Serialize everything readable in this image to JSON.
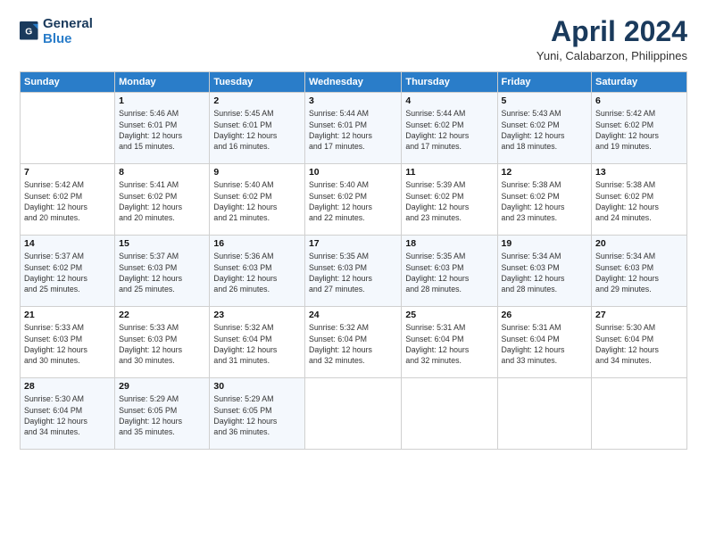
{
  "header": {
    "logo_line1": "General",
    "logo_line2": "Blue",
    "title": "April 2024",
    "location": "Yuni, Calabarzon, Philippines"
  },
  "calendar": {
    "days_of_week": [
      "Sunday",
      "Monday",
      "Tuesday",
      "Wednesday",
      "Thursday",
      "Friday",
      "Saturday"
    ],
    "weeks": [
      [
        {
          "day": "",
          "info": ""
        },
        {
          "day": "1",
          "info": "Sunrise: 5:46 AM\nSunset: 6:01 PM\nDaylight: 12 hours\nand 15 minutes."
        },
        {
          "day": "2",
          "info": "Sunrise: 5:45 AM\nSunset: 6:01 PM\nDaylight: 12 hours\nand 16 minutes."
        },
        {
          "day": "3",
          "info": "Sunrise: 5:44 AM\nSunset: 6:01 PM\nDaylight: 12 hours\nand 17 minutes."
        },
        {
          "day": "4",
          "info": "Sunrise: 5:44 AM\nSunset: 6:02 PM\nDaylight: 12 hours\nand 17 minutes."
        },
        {
          "day": "5",
          "info": "Sunrise: 5:43 AM\nSunset: 6:02 PM\nDaylight: 12 hours\nand 18 minutes."
        },
        {
          "day": "6",
          "info": "Sunrise: 5:42 AM\nSunset: 6:02 PM\nDaylight: 12 hours\nand 19 minutes."
        }
      ],
      [
        {
          "day": "7",
          "info": "Sunrise: 5:42 AM\nSunset: 6:02 PM\nDaylight: 12 hours\nand 20 minutes."
        },
        {
          "day": "8",
          "info": "Sunrise: 5:41 AM\nSunset: 6:02 PM\nDaylight: 12 hours\nand 20 minutes."
        },
        {
          "day": "9",
          "info": "Sunrise: 5:40 AM\nSunset: 6:02 PM\nDaylight: 12 hours\nand 21 minutes."
        },
        {
          "day": "10",
          "info": "Sunrise: 5:40 AM\nSunset: 6:02 PM\nDaylight: 12 hours\nand 22 minutes."
        },
        {
          "day": "11",
          "info": "Sunrise: 5:39 AM\nSunset: 6:02 PM\nDaylight: 12 hours\nand 23 minutes."
        },
        {
          "day": "12",
          "info": "Sunrise: 5:38 AM\nSunset: 6:02 PM\nDaylight: 12 hours\nand 23 minutes."
        },
        {
          "day": "13",
          "info": "Sunrise: 5:38 AM\nSunset: 6:02 PM\nDaylight: 12 hours\nand 24 minutes."
        }
      ],
      [
        {
          "day": "14",
          "info": "Sunrise: 5:37 AM\nSunset: 6:02 PM\nDaylight: 12 hours\nand 25 minutes."
        },
        {
          "day": "15",
          "info": "Sunrise: 5:37 AM\nSunset: 6:03 PM\nDaylight: 12 hours\nand 25 minutes."
        },
        {
          "day": "16",
          "info": "Sunrise: 5:36 AM\nSunset: 6:03 PM\nDaylight: 12 hours\nand 26 minutes."
        },
        {
          "day": "17",
          "info": "Sunrise: 5:35 AM\nSunset: 6:03 PM\nDaylight: 12 hours\nand 27 minutes."
        },
        {
          "day": "18",
          "info": "Sunrise: 5:35 AM\nSunset: 6:03 PM\nDaylight: 12 hours\nand 28 minutes."
        },
        {
          "day": "19",
          "info": "Sunrise: 5:34 AM\nSunset: 6:03 PM\nDaylight: 12 hours\nand 28 minutes."
        },
        {
          "day": "20",
          "info": "Sunrise: 5:34 AM\nSunset: 6:03 PM\nDaylight: 12 hours\nand 29 minutes."
        }
      ],
      [
        {
          "day": "21",
          "info": "Sunrise: 5:33 AM\nSunset: 6:03 PM\nDaylight: 12 hours\nand 30 minutes."
        },
        {
          "day": "22",
          "info": "Sunrise: 5:33 AM\nSunset: 6:03 PM\nDaylight: 12 hours\nand 30 minutes."
        },
        {
          "day": "23",
          "info": "Sunrise: 5:32 AM\nSunset: 6:04 PM\nDaylight: 12 hours\nand 31 minutes."
        },
        {
          "day": "24",
          "info": "Sunrise: 5:32 AM\nSunset: 6:04 PM\nDaylight: 12 hours\nand 32 minutes."
        },
        {
          "day": "25",
          "info": "Sunrise: 5:31 AM\nSunset: 6:04 PM\nDaylight: 12 hours\nand 32 minutes."
        },
        {
          "day": "26",
          "info": "Sunrise: 5:31 AM\nSunset: 6:04 PM\nDaylight: 12 hours\nand 33 minutes."
        },
        {
          "day": "27",
          "info": "Sunrise: 5:30 AM\nSunset: 6:04 PM\nDaylight: 12 hours\nand 34 minutes."
        }
      ],
      [
        {
          "day": "28",
          "info": "Sunrise: 5:30 AM\nSunset: 6:04 PM\nDaylight: 12 hours\nand 34 minutes."
        },
        {
          "day": "29",
          "info": "Sunrise: 5:29 AM\nSunset: 6:05 PM\nDaylight: 12 hours\nand 35 minutes."
        },
        {
          "day": "30",
          "info": "Sunrise: 5:29 AM\nSunset: 6:05 PM\nDaylight: 12 hours\nand 36 minutes."
        },
        {
          "day": "",
          "info": ""
        },
        {
          "day": "",
          "info": ""
        },
        {
          "day": "",
          "info": ""
        },
        {
          "day": "",
          "info": ""
        }
      ]
    ]
  }
}
